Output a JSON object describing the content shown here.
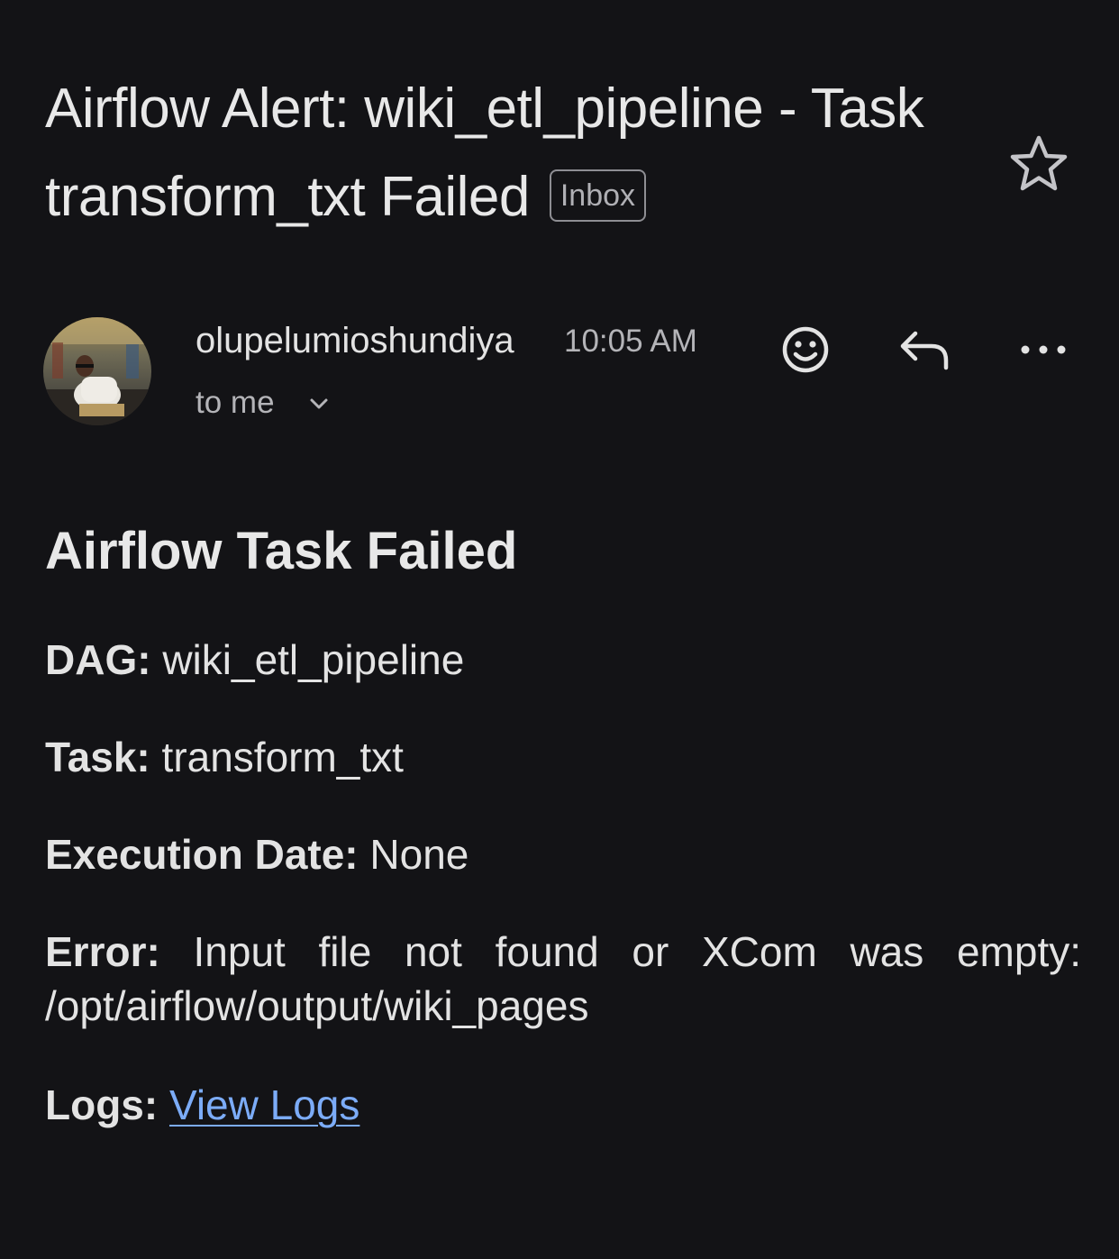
{
  "email": {
    "subject": "Airflow Alert: wiki_etl_pipeline - Task transform_txt Failed",
    "label_badge": "Inbox",
    "sender_name": "olupelumioshundiya",
    "time": "10:05 AM",
    "recipient": "to me"
  },
  "body": {
    "title": "Airflow Task Failed",
    "fields": [
      {
        "key": "DAG:",
        "value": "wiki_etl_pipeline"
      },
      {
        "key": "Task:",
        "value": "transform_txt"
      },
      {
        "key": "Execution Date:",
        "value": "None"
      },
      {
        "key": "Error:",
        "value": "Input file not found or XCom was empty: /opt/airflow/output/wiki_pages"
      },
      {
        "key": "Logs:",
        "link_text": "View Logs"
      }
    ]
  },
  "icons": {
    "star": "star-outline-icon",
    "emoji": "emoji-reaction-icon",
    "reply": "reply-icon",
    "more": "more-horizontal-icon",
    "chevron": "chevron-down-icon"
  },
  "colors": {
    "background": "#131316",
    "text": "#e3e3e3",
    "secondary_text": "#b4b4b8",
    "link": "#7cacf8"
  }
}
